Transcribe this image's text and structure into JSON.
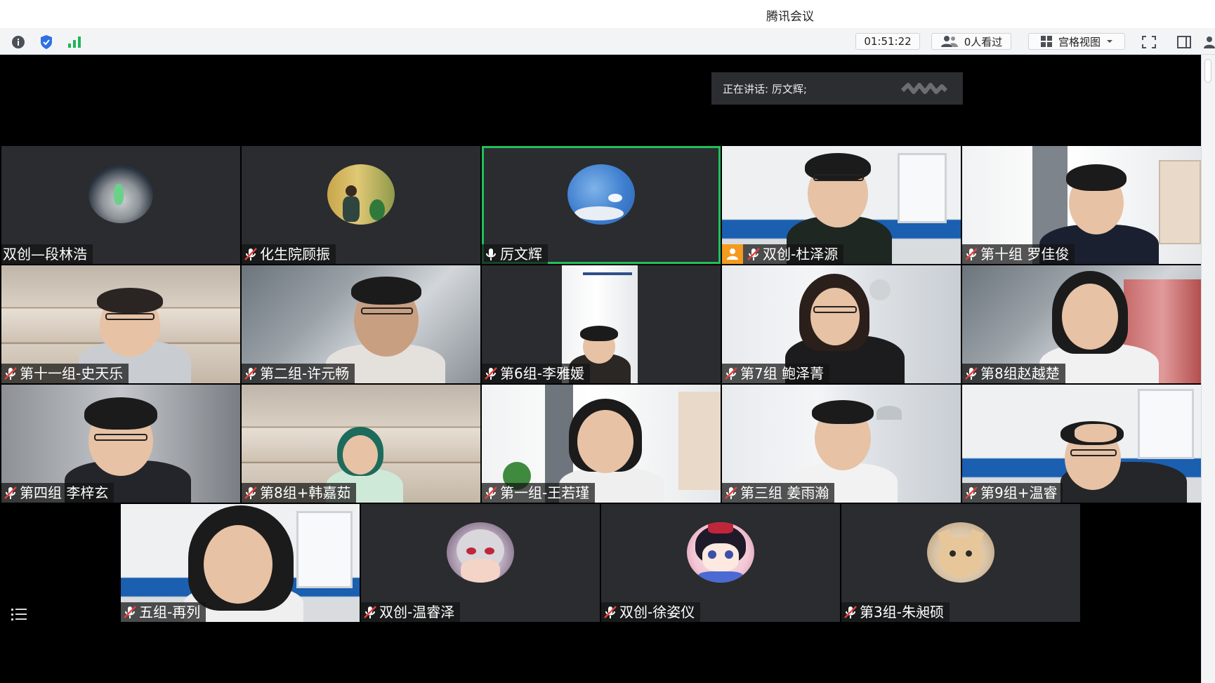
{
  "window": {
    "title": "腾讯会议"
  },
  "toolbar": {
    "timer": "01:51:22",
    "viewers": "0人看过",
    "view_mode": "宫格视图",
    "icons": [
      "info-icon",
      "shield-icon",
      "signal-icon",
      "people-icon",
      "grid-icon",
      "chevron-down-icon",
      "fullscreen-icon",
      "sidebar-toggle-icon",
      "user-icon"
    ]
  },
  "speaking": {
    "label": "正在讲话: 厉文辉;"
  },
  "participants": [
    {
      "name": "双创—段林浩",
      "mic": false
    },
    {
      "name": "化生院顾振",
      "mic": true
    },
    {
      "name": "厉文辉",
      "mic": true,
      "active": true
    },
    {
      "name": "双创-杜泽源",
      "mic": true,
      "host": true
    },
    {
      "name": "第十组 罗佳俊",
      "mic": true
    },
    {
      "name": "第十一组-史天乐",
      "mic": true
    },
    {
      "name": "第二组-许元畅",
      "mic": true
    },
    {
      "name": "第6组-李雅媛",
      "mic": true
    },
    {
      "name": "第7组 鲍泽菁",
      "mic": true
    },
    {
      "name": "第8组赵越楚",
      "mic": true
    },
    {
      "name": "第四组 李梓玄",
      "mic": true
    },
    {
      "name": "第8组+韩嘉茹",
      "mic": true
    },
    {
      "name": "第一组-王若瑾",
      "mic": true
    },
    {
      "name": "第三组 姜雨瀚",
      "mic": true
    },
    {
      "name": "第9组+温睿",
      "mic": true
    },
    {
      "name": "五组-再列",
      "mic": true
    },
    {
      "name": "双创-温睿泽",
      "mic": true
    },
    {
      "name": "双创-徐姿仪",
      "mic": true
    },
    {
      "name": "第3组-朱昶硕",
      "mic": true
    }
  ],
  "colors": {
    "active_border": "#20c05c",
    "host_badge": "#f39a1f",
    "tile_bg": "#2a2c2f"
  }
}
